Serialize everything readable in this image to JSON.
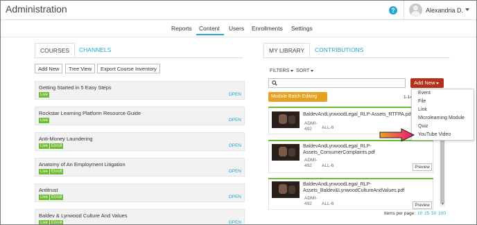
{
  "header": {
    "app_title": "Administration",
    "help_label": "?",
    "user_name": "Alexandria D."
  },
  "nav": {
    "items": [
      "Reports",
      "Content",
      "Users",
      "Enrollments",
      "Settings"
    ],
    "active": "Content"
  },
  "left": {
    "tabs": [
      "COURSES",
      "CHANNELS"
    ],
    "buttons": [
      "Add New",
      "Tree View",
      "Export Course Inventory"
    ],
    "open_label": "OPEN",
    "badge_live": "Live",
    "badge_enroll": "Enroll",
    "courses": [
      {
        "title": "Getting Started in 5 Easy Steps",
        "enroll": false
      },
      {
        "title": "Rockstar Learning Platform Resource Guide",
        "enroll": false
      },
      {
        "title": "Anti-Money Laundering",
        "enroll": true
      },
      {
        "title": "Anatomy of An Employment Litigation",
        "enroll": true
      },
      {
        "title": "Antitrust",
        "enroll": true
      },
      {
        "title": "Baldev & Lynwood Culture And Values",
        "enroll": true
      }
    ]
  },
  "right": {
    "tabs": [
      "MY LIBRARY",
      "CONTRIBUTIONS"
    ],
    "filters_label": "FILTERS",
    "sort_label": "SORT",
    "search_placeholder": "",
    "add_new_label": "Add New",
    "batch_label": "Module Batch Editing",
    "count_label": "1-14",
    "preview_label": "Preview",
    "items": [
      {
        "title": "BaldevAndLynwoodLegal_RLP-Assets_RTFPA.pdf",
        "code": "ADMI-492",
        "audience": "ALL-6"
      },
      {
        "title": "BaldevAndLynwoodLegal_RLP-Assets_ConsumerComplaints.pdf",
        "code": "ADMI-492",
        "audience": "ALL-6"
      },
      {
        "title": "BaldevAndLynwoodLegal_RLP-Assets_Baldev&LynwoodCultureAndValues.pdf",
        "code": "ADMI-492",
        "audience": "ALL-6"
      }
    ],
    "per_page_label": "Items per page:",
    "per_page_options": [
      "10",
      "25",
      "50",
      "100"
    ]
  },
  "dropdown": {
    "items": [
      "Event",
      "File",
      "Link",
      "Microlearning Module",
      "Quiz",
      "YouTube Video"
    ]
  },
  "colors": {
    "accent": "#1fa7cf",
    "add_new": "#b3311a",
    "batch": "#e8a020",
    "live_badge": "#6dbb2e",
    "arrow": "#e8147a"
  }
}
